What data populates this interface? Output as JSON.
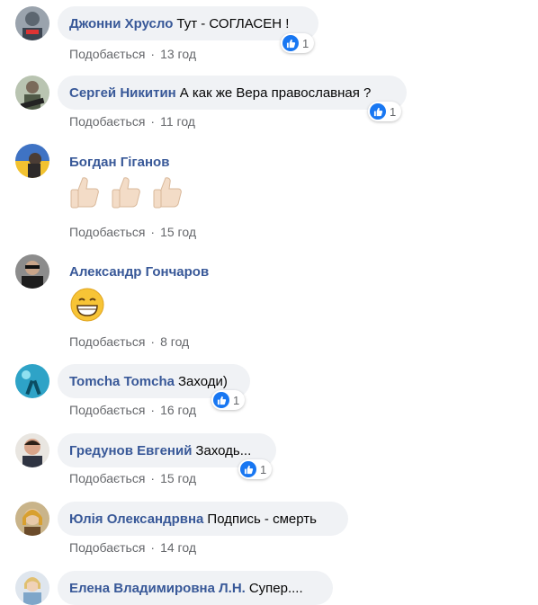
{
  "like_action": "Подобається",
  "separator": "·",
  "comments": [
    {
      "author": "Джонни Хрусло",
      "text": "Тут - СОГЛАСЕН !",
      "time": "13 год",
      "reactions": "1"
    },
    {
      "author": "Сергей Никитин",
      "text": "А как же Вера православная ?",
      "time": "11 год",
      "reactions": "1"
    },
    {
      "author": "Богдан Гіганов",
      "emoji": [
        "thumbs-up",
        "thumbs-up",
        "thumbs-up"
      ],
      "time": "15 год"
    },
    {
      "author": "Александр Гончаров",
      "emoji": [
        "grinning-face"
      ],
      "time": "8 год"
    },
    {
      "author": "Tomcha Tomcha",
      "text": "Заходи)",
      "time": "16 год",
      "reactions": "1"
    },
    {
      "author": "Гредунов Евгений",
      "text": "Заходь...",
      "time": "15 год",
      "reactions": "1"
    },
    {
      "author": "Юлія Олександрвна",
      "text": "Подпись - смерть",
      "time": "14 год"
    },
    {
      "author": "Елена Владимировна Л.Н.",
      "text": "Супер...."
    }
  ],
  "colors": {
    "author": "#385898",
    "bubble": "#f0f2f5",
    "meta": "#65676b",
    "like_blue": "#1877f2"
  }
}
